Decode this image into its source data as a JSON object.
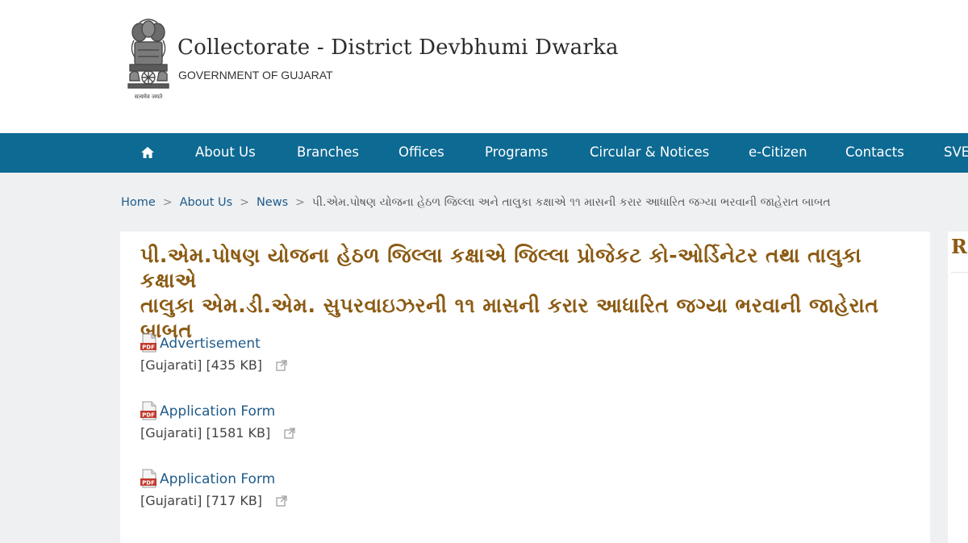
{
  "header": {
    "title": "Collectorate - District Devbhumi Dwarka",
    "subtitle": "GOVERNMENT OF GUJARAT",
    "emblem_motto": "सत्यमेव जयते"
  },
  "nav": {
    "home_icon": "home-icon",
    "items": [
      "About Us",
      "Branches",
      "Offices",
      "Programs",
      "Circular & Notices",
      "e-Citizen",
      "Contacts",
      "SVE"
    ]
  },
  "breadcrumb": {
    "items": [
      "Home",
      "About Us",
      "News"
    ],
    "current": "પી.એમ.પોષણ યોજના હેઠળ જિલ્લા અને તાલુકા કક્ષાએ ૧૧ માસની કરાર આધારિત જગ્યા ભરવાની જાહેરાત બાબત"
  },
  "article": {
    "title_lines": [
      "પી.એમ.પોષણ યોજના હેઠળ જિલ્લા કક્ષાએ જિલ્લા પ્રોજેકટ કો-ઓર્ડિનેટર તથા તાલુકા કક્ષાએ",
      "તાલુકા એમ.ડી.એમ. સુપરવાઇઝરની ૧૧ માસની કરાર આધારિત જગ્યા ભરવાની જાહેરાત",
      "બાબત"
    ],
    "documents": [
      {
        "label": "Advertisement",
        "language": "[Gujarati]",
        "size": "[435 KB]",
        "file_icon": "pdf-icon",
        "link_icon": "external-link-icon"
      },
      {
        "label": "Application Form",
        "language": "[Gujarati]",
        "size": "[1581 KB]",
        "file_icon": "pdf-icon",
        "link_icon": "external-link-icon"
      },
      {
        "label": "Application Form",
        "language": "[Gujarati]",
        "size": "[717 KB]",
        "file_icon": "pdf-icon",
        "link_icon": "external-link-icon"
      }
    ]
  },
  "sidebar": {
    "title_partial": "Re"
  },
  "colors": {
    "nav_background": "#0d6a93",
    "title_brown": "#8b5a12",
    "link_blue": "#1f5b8a",
    "page_background": "#eef0f2"
  }
}
